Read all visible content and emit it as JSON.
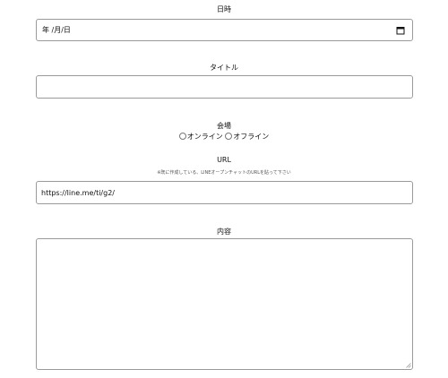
{
  "datetime": {
    "label": "日時",
    "value": "年 /月/日",
    "icon": "calendar-icon"
  },
  "title": {
    "label": "タイトル",
    "value": ""
  },
  "venue": {
    "label": "会場",
    "options": [
      "オンライン",
      "オフライン"
    ]
  },
  "url": {
    "label": "URL",
    "note": "※既に作成している、LINEオープンチャットのURLを貼って下さい",
    "value": "https://line.me/ti/g2/"
  },
  "content": {
    "label": "内容",
    "value": ""
  }
}
